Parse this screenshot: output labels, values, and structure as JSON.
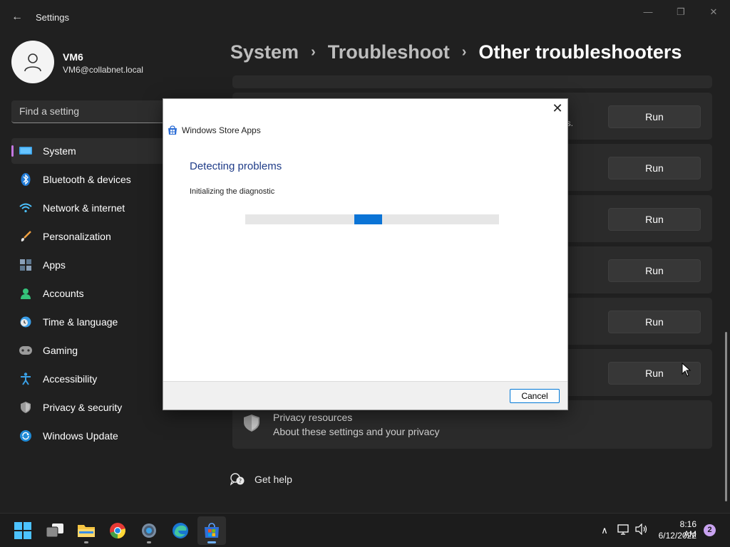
{
  "window": {
    "title": "Settings",
    "back_glyph": "←",
    "minimize_glyph": "—",
    "maximize_glyph": "❐",
    "close_glyph": "✕"
  },
  "profile": {
    "name": "VM6",
    "email": "VM6@collabnet.local"
  },
  "search": {
    "placeholder": "Find a setting"
  },
  "sidebar": {
    "items": [
      {
        "label": "System",
        "icon": "system-icon",
        "active": true
      },
      {
        "label": "Bluetooth & devices",
        "icon": "bluetooth-icon"
      },
      {
        "label": "Network & internet",
        "icon": "wifi-icon"
      },
      {
        "label": "Personalization",
        "icon": "brush-icon"
      },
      {
        "label": "Apps",
        "icon": "apps-icon"
      },
      {
        "label": "Accounts",
        "icon": "person-icon"
      },
      {
        "label": "Time & language",
        "icon": "clock-globe-icon"
      },
      {
        "label": "Gaming",
        "icon": "controller-icon"
      },
      {
        "label": "Accessibility",
        "icon": "accessibility-icon"
      },
      {
        "label": "Privacy & security",
        "icon": "shield-icon"
      },
      {
        "label": "Windows Update",
        "icon": "update-icon"
      }
    ]
  },
  "breadcrumb": {
    "items": [
      "System",
      "Troubleshoot",
      "Other troubleshooters"
    ],
    "separator": "›"
  },
  "troubleshooters": {
    "run_label": "Run",
    "partial_text": "ws."
  },
  "privacy": {
    "title": "Privacy resources",
    "link": "About these settings and your privacy"
  },
  "get_help": {
    "label": "Get help"
  },
  "dialog": {
    "title": "Windows Store Apps",
    "heading": "Detecting problems",
    "status": "Initializing the diagnostic",
    "progress_indicator": "indeterminate",
    "cancel_label": "Cancel",
    "close_glyph": "✕"
  },
  "taskbar": {
    "apps": [
      "start-icon",
      "task-view-icon",
      "file-explorer-icon",
      "chrome-icon",
      "settings-icon",
      "edge-icon",
      "store-icon"
    ],
    "active_app": "store-icon"
  },
  "tray": {
    "time": "8:16 AM",
    "date": "6/12/2022",
    "notification_count": "2",
    "chevron_glyph": "∧"
  },
  "colors": {
    "background": "#202020",
    "accent": "#c377e0",
    "progress": "#0b74d6",
    "dialog_heading": "#1f3c88"
  }
}
